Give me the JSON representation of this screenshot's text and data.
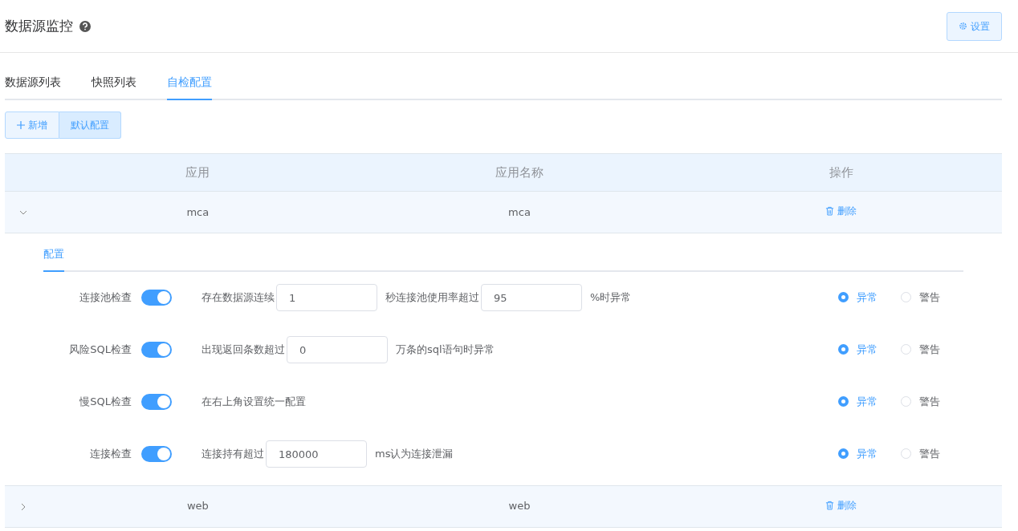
{
  "page": {
    "title": "数据源监控",
    "settings_button": "设置"
  },
  "tabs": [
    {
      "label": "数据源列表",
      "selected": false
    },
    {
      "label": "快照列表",
      "selected": false
    },
    {
      "label": "自检配置",
      "selected": true
    }
  ],
  "toolbar": {
    "add_button": "新增",
    "default_button": "默认配置"
  },
  "table": {
    "columns": [
      "应用",
      "应用名称",
      "操作"
    ],
    "rows": [
      {
        "expanded": true,
        "app": "mca",
        "app_name": "mca",
        "action": "删除",
        "detail": {
          "tabs": [
            {
              "label": "配置",
              "selected": true
            }
          ],
          "checks": [
            {
              "label": "连接池检查",
              "on": true,
              "parts": [
                {
                  "kind": "text",
                  "text": "存在数据源连续"
                },
                {
                  "kind": "input",
                  "value": "1"
                },
                {
                  "kind": "text",
                  "text": "秒连接池使用率超过"
                },
                {
                  "kind": "input",
                  "value": "95"
                },
                {
                  "kind": "text",
                  "text": "%时异常"
                }
              ],
              "options": [
                {
                  "label": "异常",
                  "selected": true
                },
                {
                  "label": "警告",
                  "selected": false
                }
              ]
            },
            {
              "label": "风险SQL检查",
              "on": true,
              "parts": [
                {
                  "kind": "text",
                  "text": "出现返回条数超过"
                },
                {
                  "kind": "input",
                  "value": "0"
                },
                {
                  "kind": "text",
                  "text": "万条的sql语句时异常"
                }
              ],
              "options": [
                {
                  "label": "异常",
                  "selected": true
                },
                {
                  "label": "警告",
                  "selected": false
                }
              ]
            },
            {
              "label": "慢SQL检查",
              "on": true,
              "parts": [
                {
                  "kind": "text",
                  "text": "在右上角设置统一配置"
                }
              ],
              "options": [
                {
                  "label": "异常",
                  "selected": true
                },
                {
                  "label": "警告",
                  "selected": false
                }
              ]
            },
            {
              "label": "连接检查",
              "on": true,
              "parts": [
                {
                  "kind": "text",
                  "text": "连接持有超过"
                },
                {
                  "kind": "input",
                  "value": "180000"
                },
                {
                  "kind": "text",
                  "text": "ms认为连接泄漏"
                }
              ],
              "options": [
                {
                  "label": "异常",
                  "selected": true
                },
                {
                  "label": "警告",
                  "selected": false
                }
              ]
            }
          ]
        }
      },
      {
        "expanded": false,
        "app": "web",
        "app_name": "web",
        "action": "删除"
      }
    ]
  }
}
